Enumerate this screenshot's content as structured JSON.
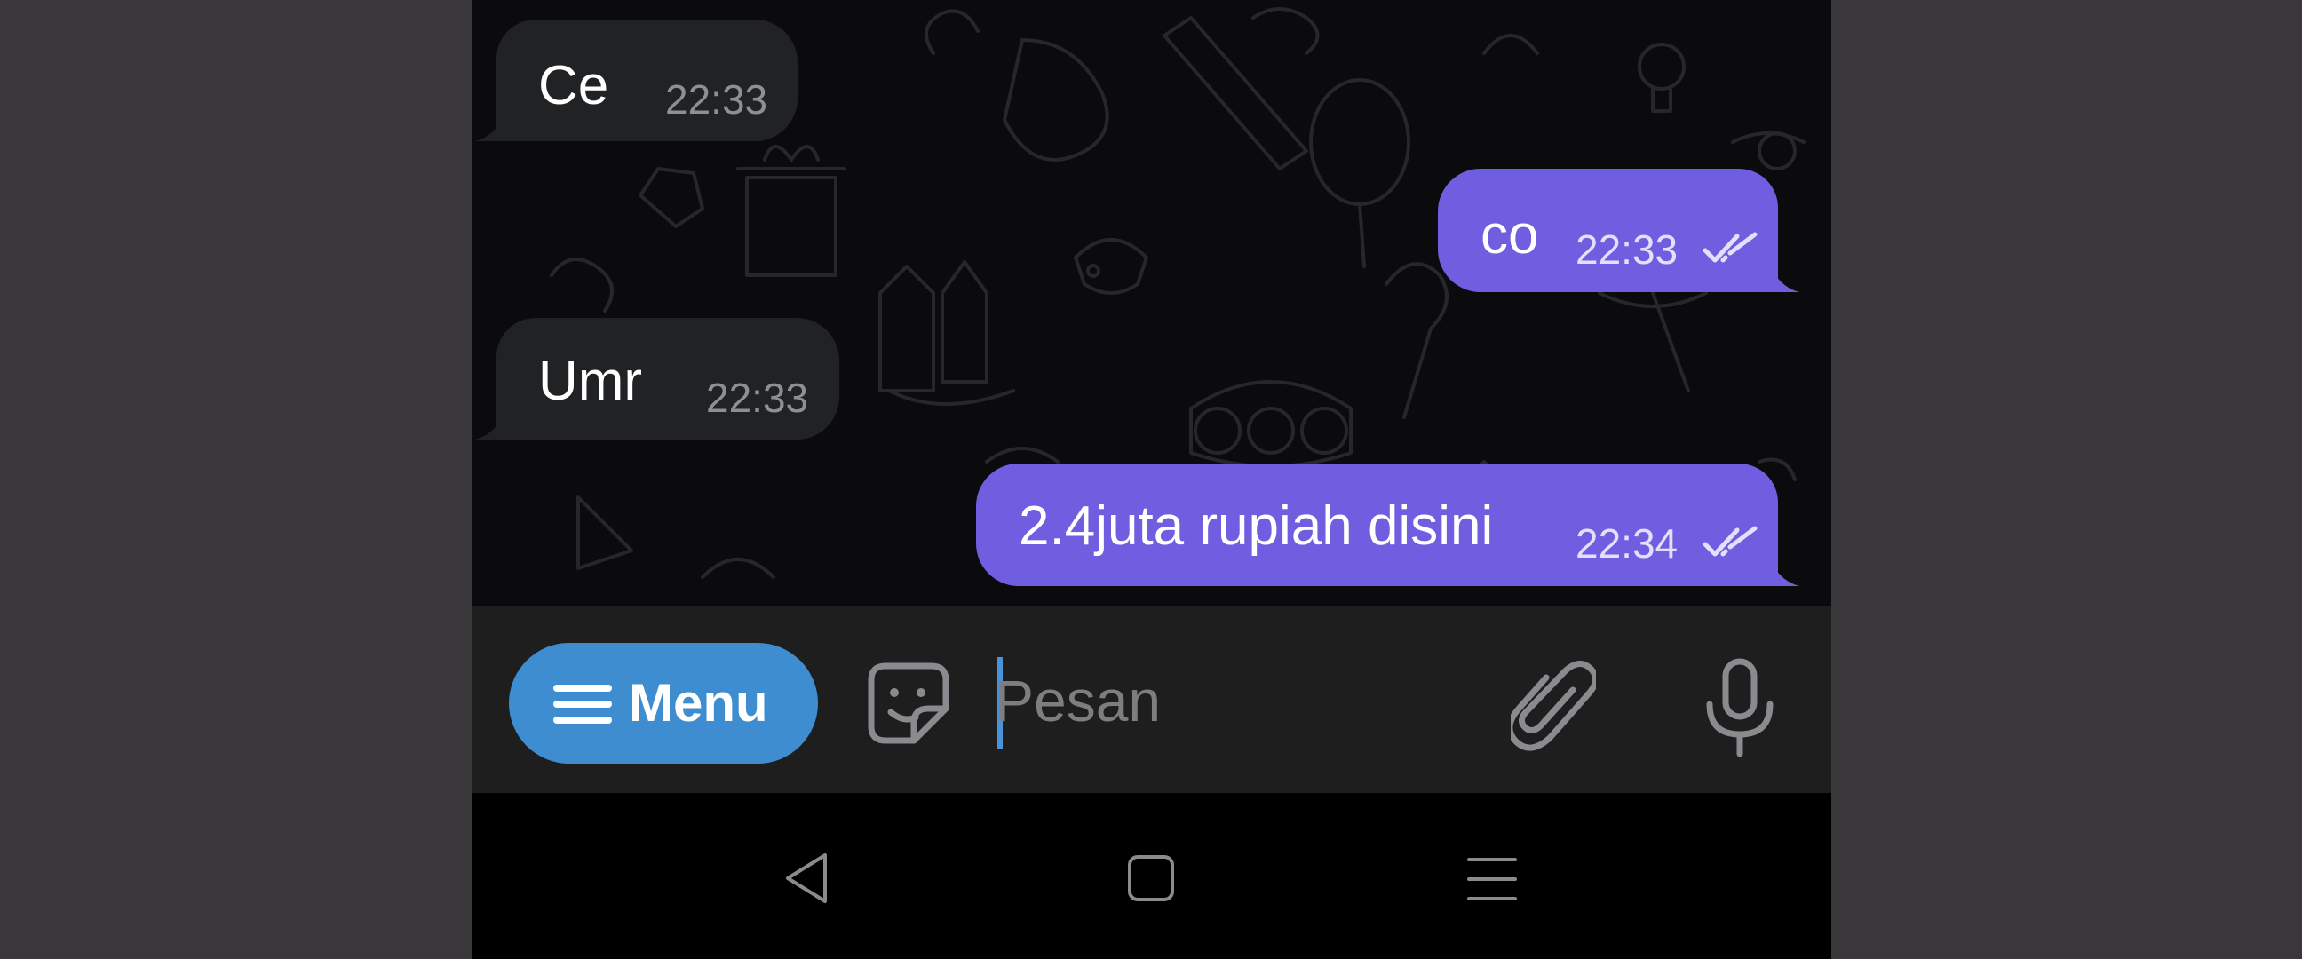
{
  "messages": [
    {
      "direction": "incoming",
      "text": "Ce",
      "time": "22:33"
    },
    {
      "direction": "outgoing",
      "text": "co",
      "time": "22:33",
      "status": "read"
    },
    {
      "direction": "incoming",
      "text": "Umr",
      "time": "22:33"
    },
    {
      "direction": "outgoing",
      "text": "2.4juta rupiah disini",
      "time": "22:34",
      "status": "read"
    }
  ],
  "input_bar": {
    "menu_label": "Menu",
    "placeholder": "Pesan",
    "value": "",
    "icons": [
      "menu-icon",
      "sticker-icon",
      "paperclip-icon",
      "microphone-icon"
    ]
  },
  "nav_bar": {
    "icons": [
      "back-icon",
      "home-icon",
      "recents-icon"
    ]
  },
  "colors": {
    "outgoing_bubble": "#6f5ee0",
    "incoming_bubble": "#212224",
    "menu_button": "#3e8dd0",
    "input_bar": "#1e1e1f",
    "chat_background": "#0b0b0d",
    "caret": "#4a93d8"
  }
}
